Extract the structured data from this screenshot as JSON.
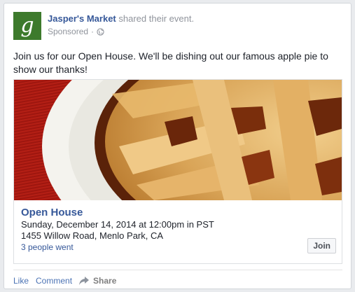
{
  "post": {
    "page_name": "Jasper's Market",
    "action_text": "shared their event.",
    "sponsored": "Sponsored",
    "dot": "·",
    "avatar_letter": "g",
    "text": "Join us for our Open House. We'll be dishing out our famous apple pie to show our thanks!"
  },
  "event": {
    "title": "Open House",
    "date": "Sunday, December 14, 2014 at 12:00pm in PST",
    "address": "1455 Willow Road, Menlo Park, CA",
    "going": "3 people went",
    "join_label": "Join"
  },
  "footer": {
    "like": "Like",
    "comment": "Comment",
    "share": "Share"
  },
  "icons": {
    "globe": "globe-icon",
    "share": "share-arrow-icon"
  },
  "colors": {
    "brand_green": "#3d7a2c",
    "link_blue": "#365899"
  }
}
